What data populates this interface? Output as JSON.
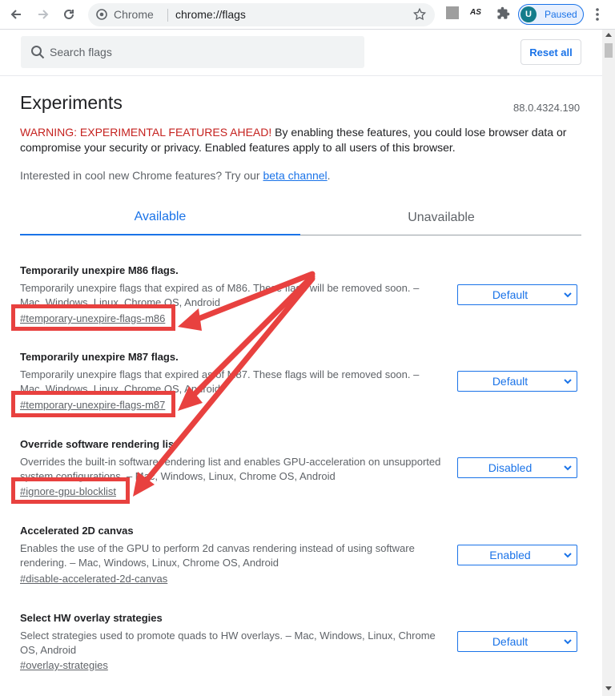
{
  "browser": {
    "chip_label": "Chrome",
    "url": "chrome://flags",
    "profile_initial": "U",
    "profile_status": "Paused",
    "extension_label": "AS"
  },
  "header": {
    "search_placeholder": "Search flags",
    "reset_label": "Reset all"
  },
  "page": {
    "title": "Experiments",
    "version": "88.0.4324.190",
    "warning_prefix": "WARNING: EXPERIMENTAL FEATURES AHEAD!",
    "warning_text": " By enabling these features, you could lose browser data or compromise your security or privacy. Enabled features apply to all users of this browser.",
    "interest_text": "Interested in cool new Chrome features? Try our ",
    "interest_link": "beta channel",
    "interest_suffix": "."
  },
  "tabs": [
    {
      "label": "Available",
      "active": true
    },
    {
      "label": "Unavailable",
      "active": false
    }
  ],
  "flags": [
    {
      "name": "Temporarily unexpire M86 flags.",
      "description": "Temporarily unexpire flags that expired as of M86. These flags will be removed soon. – Mac, Windows, Linux, Chrome OS, Android",
      "link": "#temporary-unexpire-flags-m86",
      "value": "Default",
      "highlighted": true
    },
    {
      "name": "Temporarily unexpire M87 flags.",
      "description": "Temporarily unexpire flags that expired as of M87. These flags will be removed soon. – Mac, Windows, Linux, Chrome OS, Android",
      "link": "#temporary-unexpire-flags-m87",
      "value": "Default",
      "highlighted": true
    },
    {
      "name": "Override software rendering list",
      "description": "Overrides the built-in software rendering list and enables GPU-acceleration on unsupported system configurations. – Mac, Windows, Linux, Chrome OS, Android",
      "link": "#ignore-gpu-blocklist",
      "value": "Disabled",
      "highlighted": true
    },
    {
      "name": "Accelerated 2D canvas",
      "description": "Enables the use of the GPU to perform 2d canvas rendering instead of using software rendering. – Mac, Windows, Linux, Chrome OS, Android",
      "link": "#disable-accelerated-2d-canvas",
      "value": "Enabled",
      "highlighted": false
    },
    {
      "name": "Select HW overlay strategies",
      "description": "Select strategies used to promote quads to HW overlays. – Mac, Windows, Linux, Chrome OS, Android",
      "link": "#overlay-strategies",
      "value": "Default",
      "highlighted": false
    }
  ],
  "colors": {
    "accent": "#1a73e8",
    "warning": "#c5221f",
    "annotation": "#e8413f"
  }
}
